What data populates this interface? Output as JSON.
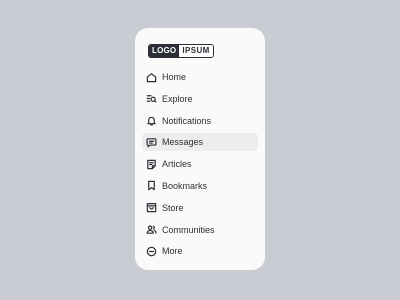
{
  "logo": {
    "part1": "LOGO",
    "part2": "IPSUM"
  },
  "nav": {
    "items": [
      {
        "label": "Home",
        "icon": "home-icon",
        "active": false
      },
      {
        "label": "Explore",
        "icon": "explore-icon",
        "active": false
      },
      {
        "label": "Notifications",
        "icon": "bell-icon",
        "active": false
      },
      {
        "label": "Messages",
        "icon": "message-icon",
        "active": true
      },
      {
        "label": "Articles",
        "icon": "article-icon",
        "active": false
      },
      {
        "label": "Bookmarks",
        "icon": "bookmark-icon",
        "active": false
      },
      {
        "label": "Store",
        "icon": "store-icon",
        "active": false
      },
      {
        "label": "Communities",
        "icon": "communities-icon",
        "active": false
      },
      {
        "label": "More",
        "icon": "more-icon",
        "active": false
      }
    ]
  },
  "colors": {
    "background": "#c9ccd3",
    "card": "#fafafa",
    "active_item": "#ededee",
    "text": "#2b2e36"
  }
}
